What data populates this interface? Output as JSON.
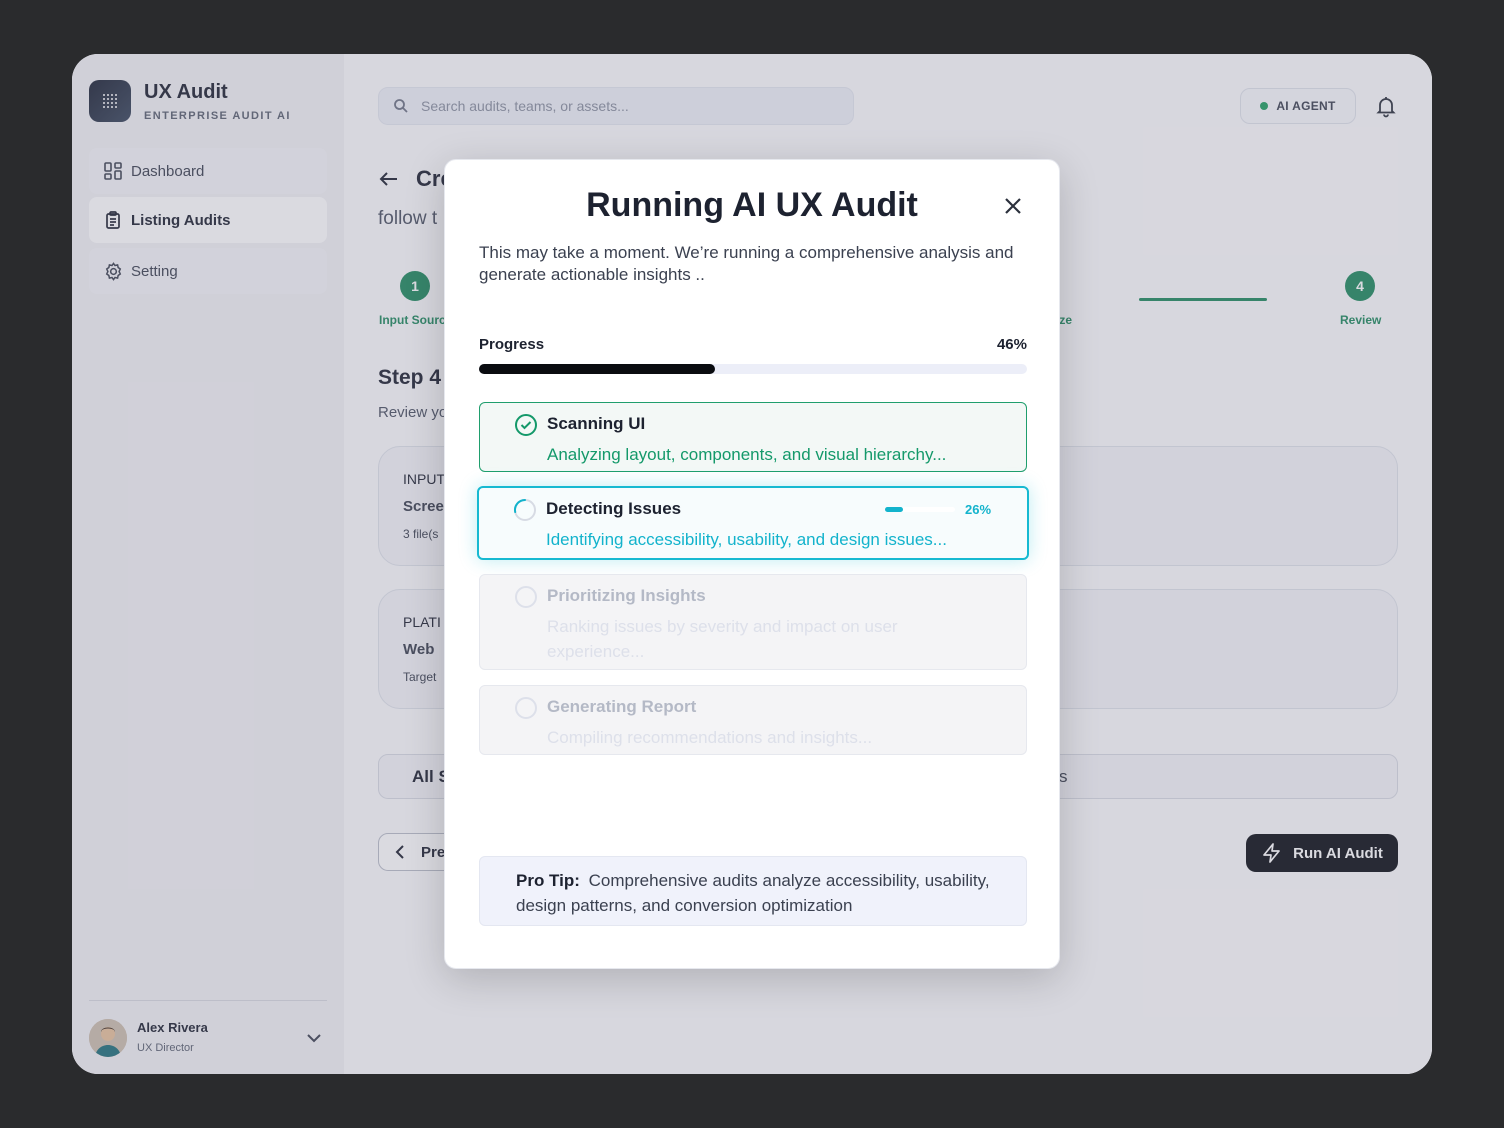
{
  "brand": {
    "title": "UX Audit",
    "subtitle": "ENTERPRISE AUDIT AI"
  },
  "sidebar": {
    "items": [
      {
        "label": "Dashboard",
        "icon": "dashboard-icon",
        "active": false
      },
      {
        "label": "Listing Audits",
        "icon": "clipboard-icon",
        "active": true
      },
      {
        "label": "Setting",
        "icon": "gear-icon",
        "active": false
      }
    ]
  },
  "user": {
    "name": "Alex Rivera",
    "role": "UX Director"
  },
  "header": {
    "search_placeholder": "Search audits, teams, or assets...",
    "ai_badge": "AI AGENT"
  },
  "page": {
    "title": "Cre",
    "subtitle": "follow t",
    "steps": [
      {
        "number": "1",
        "label": "Input Sourc"
      },
      {
        "number": "",
        "label": "ize"
      },
      {
        "number": "4",
        "label": "Review"
      }
    ],
    "section_title": "Step 4",
    "section_sub": "Review yo",
    "cards": [
      {
        "label": "INPUT",
        "value": "Scree",
        "meta": "3 file(s"
      },
      {
        "label": "PLATI",
        "value": "Web",
        "meta": "Target"
      }
    ],
    "filter_label": "All S",
    "filter_end": "s",
    "prev_button": "Pre",
    "run_button": "Run AI Audit"
  },
  "modal": {
    "title": "Running AI UX Audit",
    "description": "This may take a moment. We’re running a comprehensive analysis and generate actionable insights ..",
    "progress_label": "Progress",
    "progress_value": "46%",
    "progress_fraction": 0.43,
    "tasks": [
      {
        "title": "Scanning UI",
        "description": "Analyzing layout, components, and visual hierarchy...",
        "status": "done"
      },
      {
        "title": "Detecting Issues",
        "description": "Identifying accessibility, usability, and design issues...",
        "status": "active",
        "progress_value": "26%",
        "progress_fraction": 0.26
      },
      {
        "title": "Prioritizing Insights",
        "description": "Ranking issues by severity and impact on user experience...",
        "status": "pending"
      },
      {
        "title": "Generating Report",
        "description": "Compiling recommendations and insights...",
        "status": "pending"
      }
    ],
    "tip_label": "Pro Tip:",
    "tip_text": "Comprehensive audits analyze accessibility, usability, design patterns, and conversion optimization"
  },
  "colors": {
    "accent_green": "#1f8a5e",
    "accent_cyan": "#16b9d1",
    "primary_dark": "#0a0c10"
  }
}
